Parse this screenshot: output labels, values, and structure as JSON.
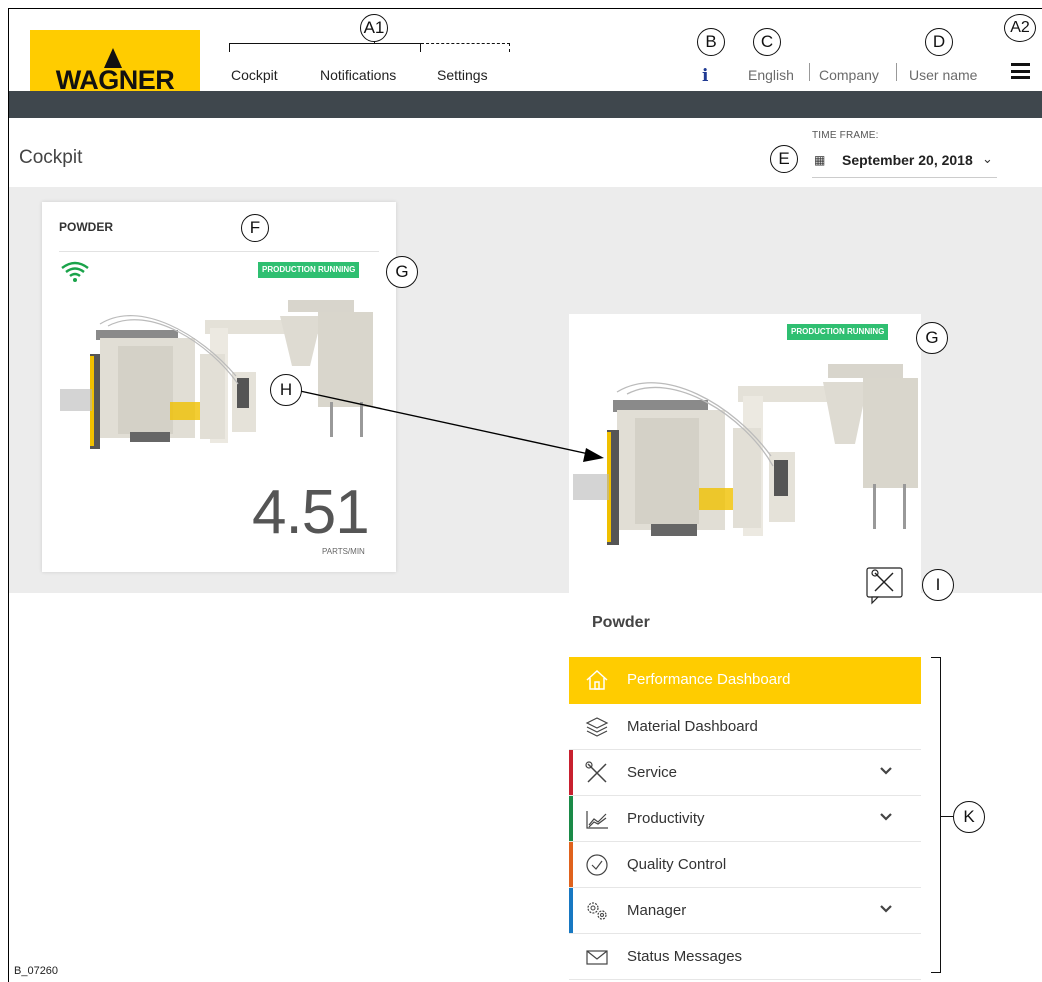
{
  "brand": {
    "logo_text": "WAGNER",
    "color": "#ffcc00"
  },
  "nav": {
    "items": [
      {
        "label": "Cockpit"
      },
      {
        "label": "Notifications"
      },
      {
        "label": "Settings"
      }
    ]
  },
  "header": {
    "info_icon": "info-icon",
    "language": "English",
    "company": "Company",
    "user": "User name",
    "menu_icon": "hamburger-icon"
  },
  "page": {
    "title": "Cockpit",
    "time_frame_label": "TIME FRAME:",
    "time_frame_value": "September 20, 2018"
  },
  "card": {
    "title": "POWDER",
    "status": "PRODUCTION RUNNING",
    "value": "4.51",
    "unit": "PARTS/MIN",
    "status_color": "#2fbf71"
  },
  "detail": {
    "status": "PRODUCTION RUNNING",
    "name": "Powder",
    "menu": [
      {
        "label": "Performance Dashboard",
        "icon": "home-icon",
        "active": true
      },
      {
        "label": "Material Dashboard",
        "icon": "layers-icon"
      },
      {
        "label": "Service",
        "icon": "tools-icon",
        "accent": "#c8202f",
        "expandable": true
      },
      {
        "label": "Productivity",
        "icon": "chart-icon",
        "accent": "#1a8a47",
        "expandable": true
      },
      {
        "label": "Quality Control",
        "icon": "check-circle-icon",
        "accent": "#e0621d"
      },
      {
        "label": "Manager",
        "icon": "gears-icon",
        "accent": "#1778c2",
        "expandable": true
      },
      {
        "label": "Status Messages",
        "icon": "envelope-icon"
      }
    ]
  },
  "callouts": {
    "a1": "A1",
    "a2": "A2",
    "b": "B",
    "c": "C",
    "d": "D",
    "e": "E",
    "f": "F",
    "g": "G",
    "h": "H",
    "i": "I",
    "k": "K"
  },
  "figure_ref": "B_07260"
}
